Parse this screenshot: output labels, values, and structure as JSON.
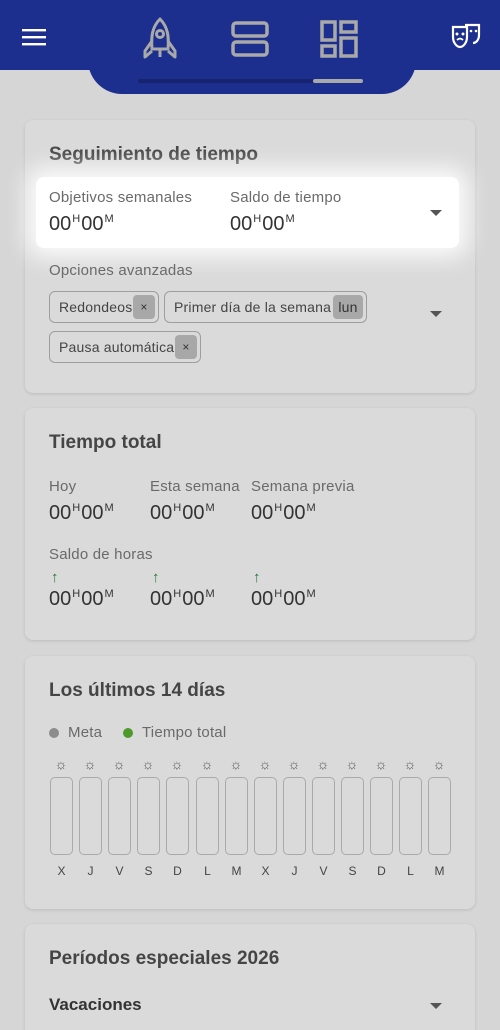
{
  "header": {
    "menu_icon": "hamburger-icon",
    "tabs": [
      {
        "icon": "rocket-icon"
      },
      {
        "icon": "rows-icon"
      },
      {
        "icon": "dashboard-icon"
      }
    ],
    "right_icon": "theater-masks-icon",
    "accent": "#1d2f8e"
  },
  "tracking": {
    "title": "Seguimiento de tiempo",
    "weekly_goal_label": "Objetivos semanales",
    "weekly_goal": {
      "h": "00",
      "m": "00"
    },
    "balance_label": "Saldo de tiempo",
    "balance": {
      "h": "00",
      "m": "00"
    },
    "advanced_label": "Opciones avanzadas",
    "chips": [
      {
        "label": "Redondeos",
        "close": "×"
      },
      {
        "label": "Primer día de la semana",
        "tag": "lun"
      },
      {
        "label": "Pausa automática",
        "close": "×"
      }
    ]
  },
  "units": {
    "h": "H",
    "m": "M"
  },
  "total": {
    "title": "Tiempo total",
    "today_label": "Hoy",
    "today": {
      "h": "00",
      "m": "00"
    },
    "week_label": "Esta semana",
    "week": {
      "h": "00",
      "m": "00"
    },
    "prev_label": "Semana previa",
    "prev": {
      "h": "00",
      "m": "00"
    },
    "balance_label": "Saldo de horas",
    "balances": [
      {
        "arrow": "↑",
        "h": "00",
        "m": "00"
      },
      {
        "arrow": "↑",
        "h": "00",
        "m": "00"
      },
      {
        "arrow": "↑",
        "h": "00",
        "m": "00"
      }
    ],
    "arrow_color": "#1f7a3c"
  },
  "chart_data": {
    "type": "bar",
    "title": "Los últimos 14 días",
    "categories": [
      "X",
      "J",
      "V",
      "S",
      "D",
      "L",
      "M",
      "X",
      "J",
      "V",
      "S",
      "D",
      "L",
      "M"
    ],
    "series": [
      {
        "name": "Meta",
        "values": [
          0,
          0,
          0,
          0,
          0,
          0,
          0,
          0,
          0,
          0,
          0,
          0,
          0,
          0
        ],
        "color": "#8c8c8c"
      },
      {
        "name": "Tiempo total",
        "values": [
          0,
          0,
          0,
          0,
          0,
          0,
          0,
          0,
          0,
          0,
          0,
          0,
          0,
          0
        ],
        "color": "#4d9a2b"
      }
    ],
    "legend": "top-left"
  },
  "special": {
    "title": "Períodos especiales 2026",
    "vacation_label": "Vacaciones"
  }
}
